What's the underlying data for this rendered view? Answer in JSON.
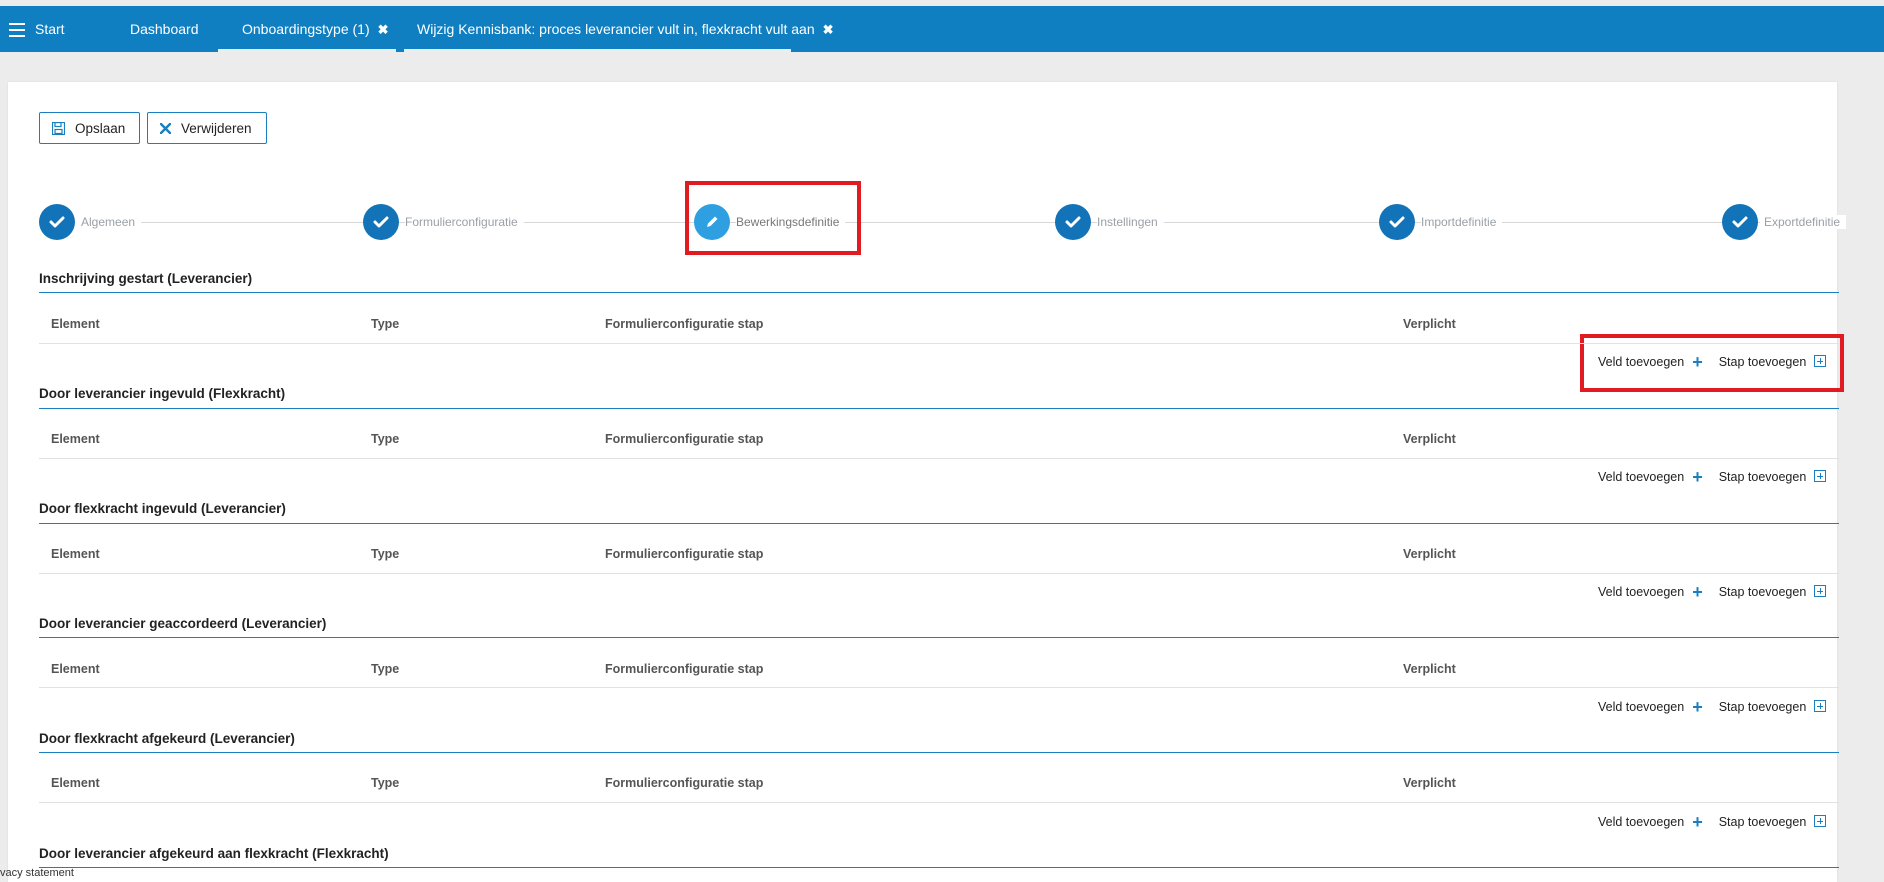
{
  "nav": {
    "start_label": "Start",
    "tabs": [
      {
        "label": "Dashboard"
      },
      {
        "label": "Onboardingstype (1)"
      },
      {
        "label": "Wijzig Kennisbank: proces leverancier vult in, flexkracht vult aan"
      }
    ],
    "close_glyph": "✖"
  },
  "toolbar": {
    "save_label": "Opslaan",
    "delete_label": "Verwijderen"
  },
  "steps": [
    {
      "label": "Algemeen",
      "state": "done"
    },
    {
      "label": "Formulierconfiguratie",
      "state": "done"
    },
    {
      "label": "Bewerkingsdefinitie",
      "state": "current"
    },
    {
      "label": "Instellingen",
      "state": "done"
    },
    {
      "label": "Importdefinitie",
      "state": "done"
    },
    {
      "label": "Exportdefinitie",
      "state": "done"
    }
  ],
  "columns": {
    "element": "Element",
    "type": "Type",
    "step": "Formulierconfiguratie stap",
    "required": "Verplicht"
  },
  "actions": {
    "add_field": "Veld toevoegen",
    "add_step": "Stap toevoegen"
  },
  "sections": [
    {
      "title": "Inschrijving gestart (Leverancier)"
    },
    {
      "title": "Door leverancier ingevuld (Flexkracht)"
    },
    {
      "title": "Door flexkracht ingevuld (Leverancier)"
    },
    {
      "title": "Door leverancier geaccordeerd (Leverancier)"
    },
    {
      "title": "Door flexkracht afgekeurd (Leverancier)"
    },
    {
      "title": "Door leverancier afgekeurd aan flexkracht (Flexkracht)"
    }
  ],
  "footer": {
    "privacy": "vacy statement"
  },
  "colors": {
    "brand": "#0f7fc1",
    "step_done": "#1373b8",
    "step_current": "#2e9fe0",
    "highlight": "#e11b22"
  }
}
